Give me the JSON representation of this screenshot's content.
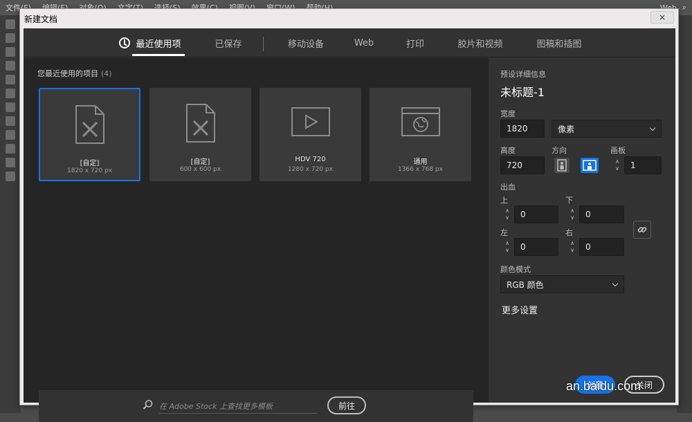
{
  "app": {
    "menu": [
      "文件(F)",
      "编辑(E)",
      "对象(O)",
      "文字(T)",
      "选择(S)",
      "效果(C)",
      "视图(V)",
      "窗口(W)",
      "帮助(H)"
    ],
    "workspace": "Web"
  },
  "dialog": {
    "title": "新建文档",
    "close_label": "×"
  },
  "tabs": [
    {
      "label": "最近使用项",
      "active": true
    },
    {
      "label": "已保存"
    },
    {
      "label": "移动设备"
    },
    {
      "label": "Web"
    },
    {
      "label": "打印"
    },
    {
      "label": "胶片和视频"
    },
    {
      "label": "图稿和插图"
    }
  ],
  "recent": {
    "label": "您最近使用的项目",
    "count": "(4)",
    "items": [
      {
        "name": "[自定]",
        "size": "1820 x 720 px",
        "icon": "custom-doc-icon",
        "selected": true
      },
      {
        "name": "[自定]",
        "size": "600 x 600 px",
        "icon": "custom-doc-icon"
      },
      {
        "name": "HDV 720",
        "size": "1280 x 720 px",
        "icon": "video-icon"
      },
      {
        "name": "通用",
        "size": "1366 x 768 px",
        "icon": "web-icon"
      }
    ]
  },
  "stock": {
    "placeholder": "在 Adobe Stock 上查找更多模板",
    "go_label": "前往"
  },
  "preset": {
    "section_label": "预设详细信息",
    "doc_title": "未标题-1",
    "width_label": "宽度",
    "width_value": "1820",
    "unit": "像素",
    "height_label": "高度",
    "height_value": "720",
    "orientation_label": "方向",
    "artboards_label": "画板",
    "artboards_value": "1",
    "bleed_label": "出血",
    "bleed_top_label": "上",
    "bleed_top": "0",
    "bleed_bottom_label": "下",
    "bleed_bottom": "0",
    "bleed_left_label": "左",
    "bleed_left": "0",
    "bleed_right_label": "右",
    "bleed_right": "0",
    "color_mode_label": "颜色模式",
    "color_mode": "RGB 颜色",
    "more_settings": "更多设置",
    "create_label": "创建",
    "close_label": "关闭"
  },
  "colors": {
    "accent": "#1473e6",
    "panel": "#323232",
    "content": "#252525"
  },
  "watermark": "an.baidu.com"
}
